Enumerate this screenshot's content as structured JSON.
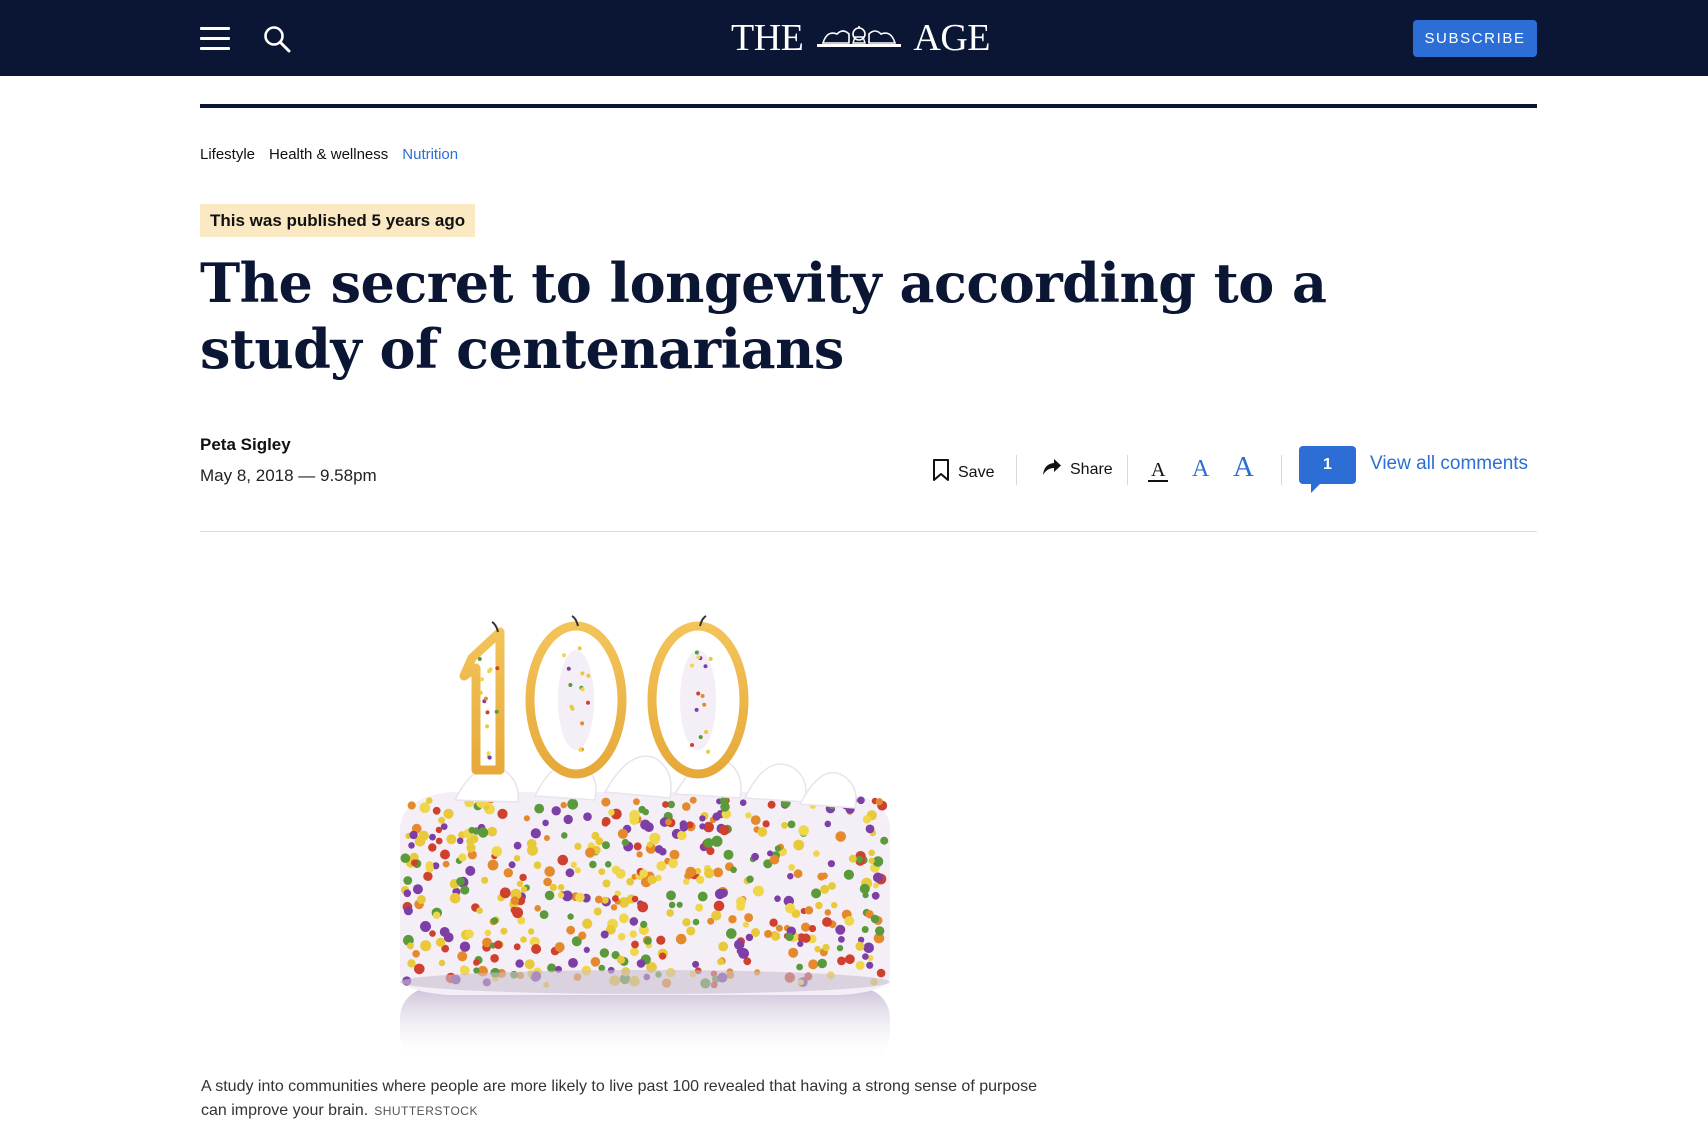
{
  "header": {
    "logo_left": "THE",
    "logo_right": "AGE",
    "subscribe_label": "SUBSCRIBE",
    "menu_icon": "hamburger-menu-icon",
    "search_icon": "search-icon"
  },
  "breadcrumb": [
    {
      "label": "Lifestyle"
    },
    {
      "label": "Health & wellness"
    },
    {
      "label": "Nutrition",
      "active": true
    }
  ],
  "article": {
    "published_notice": "This was published 5 years ago",
    "headline": "The secret to longevity according to a study of centenarians",
    "author": "Peta Sigley",
    "date": "May 8, 2018 — 9.58pm"
  },
  "tools": {
    "save_label": "Save",
    "share_label": "Share",
    "font_small": "A",
    "font_medium": "A",
    "font_large": "A",
    "comment_count": "1",
    "view_comments_label": "View all comments"
  },
  "image": {
    "candle_number": "100",
    "caption": "A study into communities where people are more likely to live past 100 revealed that having a strong sense of purpose can improve your brain.",
    "credit": "SHUTTERSTOCK"
  },
  "colors": {
    "navy": "#0a1633",
    "accent_blue": "#2c6ed6",
    "badge_bg": "#fbe9c4"
  }
}
